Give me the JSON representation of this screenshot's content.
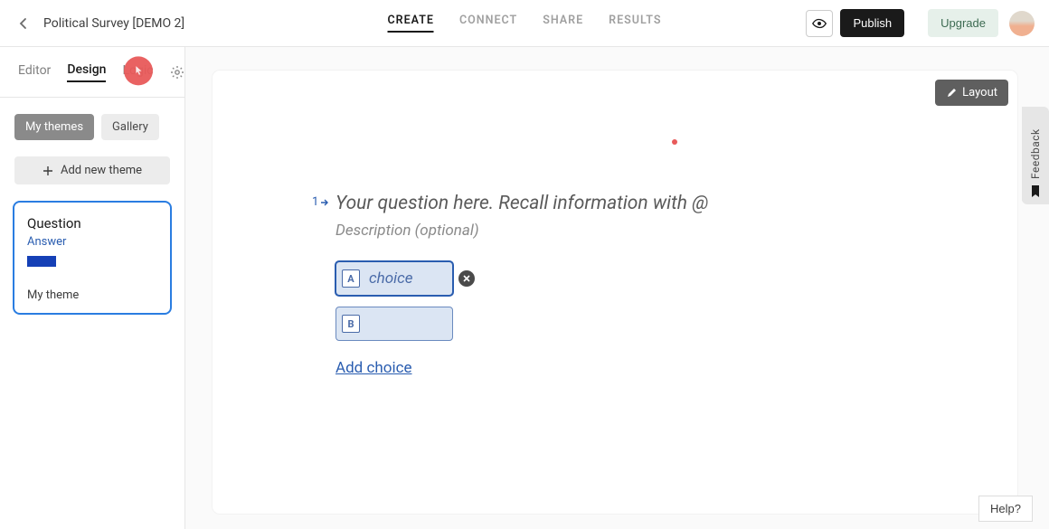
{
  "header": {
    "title": "Political Survey [DEMO 2]",
    "tabs": {
      "create": "CREATE",
      "connect": "CONNECT",
      "share": "SHARE",
      "results": "RESULTS"
    },
    "publish": "Publish",
    "upgrade": "Upgrade"
  },
  "sidebar": {
    "tabs": {
      "editor": "Editor",
      "design": "Design",
      "logic": "Logic"
    },
    "filter": {
      "mythemes": "My themes",
      "gallery": "Gallery"
    },
    "add_theme": "Add new theme",
    "theme_card": {
      "question": "Question",
      "answer": "Answer",
      "name": "My theme"
    }
  },
  "canvas": {
    "layout_btn": "Layout",
    "question_number": "1",
    "question_placeholder": "Your question here. Recall information with @",
    "description_placeholder": "Description (optional)",
    "choices": [
      {
        "key": "A",
        "text": "choice",
        "selected": true
      },
      {
        "key": "B",
        "text": "",
        "selected": false
      }
    ],
    "add_choice": "Add choice"
  },
  "feedback": "Feedback",
  "help": "Help?",
  "colors": {
    "accent": "#2a5db0",
    "hotspot": "#e85a5a"
  }
}
